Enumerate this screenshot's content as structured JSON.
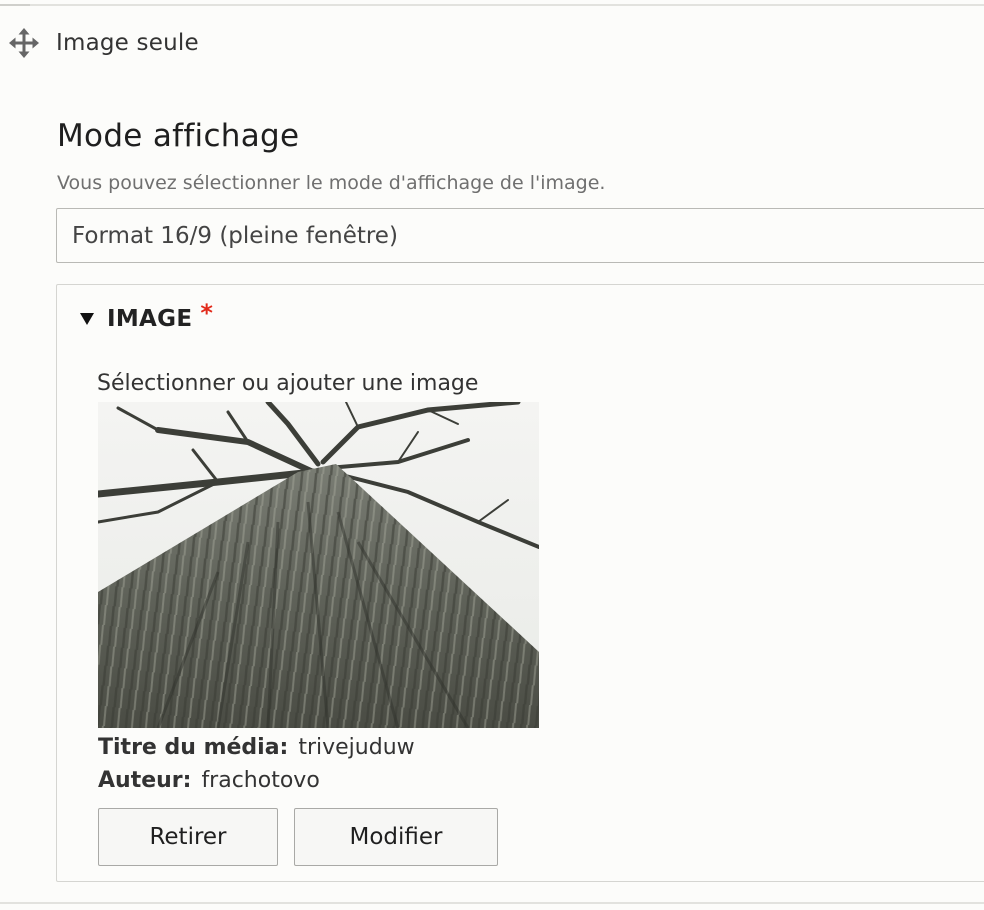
{
  "paragraph": {
    "type_label": "Image seule"
  },
  "display_mode": {
    "label": "Mode affichage",
    "description": "Vous pouvez sélectionner le mode d'affichage de l'image.",
    "selected": "Format 16/9 (pleine fenêtre)"
  },
  "image_field": {
    "summary": "IMAGE",
    "required_mark": "*",
    "select_hint": "Sélectionner ou ajouter une image",
    "media_title_label": "Titre du média:",
    "media_title_value": "trivejuduw",
    "author_label": "Auteur:",
    "author_value": "frachotovo",
    "remove_label": "Retirer",
    "edit_label": "Modifier"
  },
  "colors": {
    "required": "#e22a1a",
    "border": "#b9b9b5"
  }
}
